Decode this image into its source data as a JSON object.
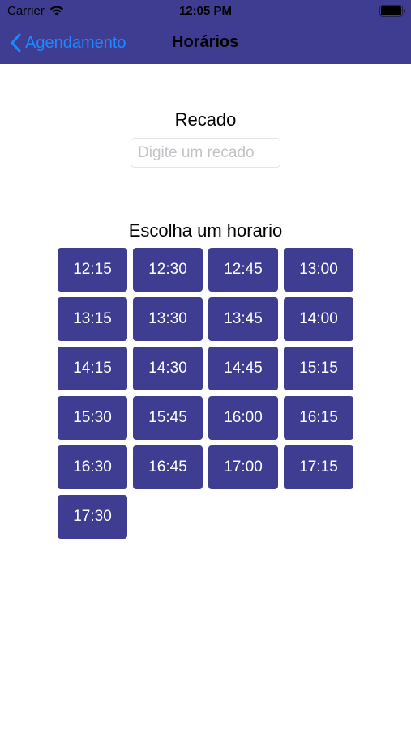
{
  "status_bar": {
    "carrier": "Carrier",
    "time": "12:05 PM",
    "wifi_icon": "wifi-icon",
    "battery_icon": "battery-icon"
  },
  "nav": {
    "back_label": "Agendamento",
    "back_icon": "chevron-left-icon",
    "title": "Horários"
  },
  "recado": {
    "label": "Recado",
    "placeholder": "Digite um recado",
    "value": ""
  },
  "horarios": {
    "label": "Escolha um horario",
    "slots": [
      "12:15",
      "12:30",
      "12:45",
      "13:00",
      "13:15",
      "13:30",
      "13:45",
      "14:00",
      "14:15",
      "14:30",
      "14:45",
      "15:15",
      "15:30",
      "15:45",
      "16:00",
      "16:15",
      "16:30",
      "16:45",
      "17:00",
      "17:15",
      "17:30"
    ]
  },
  "colors": {
    "primary": "#3f3d91",
    "link": "#1e88ff"
  }
}
